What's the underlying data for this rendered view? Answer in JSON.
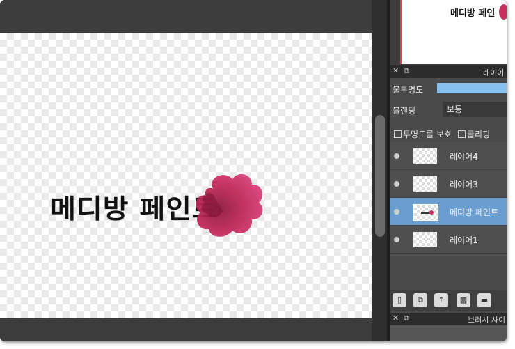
{
  "canvas": {
    "text": "메디방 페인트",
    "ink_color": "#c7305e"
  },
  "navigator": {
    "text": "메디방 페인"
  },
  "layer_panel": {
    "title": "레이어",
    "opacity_label": "불투명도",
    "blending_label": "블렌딩",
    "blending_value": "보통",
    "protect_alpha_label": "투명도를 보호",
    "clipping_label": "클리핑",
    "accent_color": "#6a9dd0",
    "layers": [
      {
        "name": "레이어4",
        "selected": false
      },
      {
        "name": "레이어3",
        "selected": false
      },
      {
        "name": "메디방 페인트",
        "selected": true
      },
      {
        "name": "레이어1",
        "selected": false
      }
    ],
    "toolbar_icons": [
      "new-layer-icon",
      "copy-layer-icon",
      "import-layer-icon",
      "mask-layer-icon",
      "folder-icon"
    ]
  },
  "brush_panel": {
    "title": "브러시 사이"
  }
}
